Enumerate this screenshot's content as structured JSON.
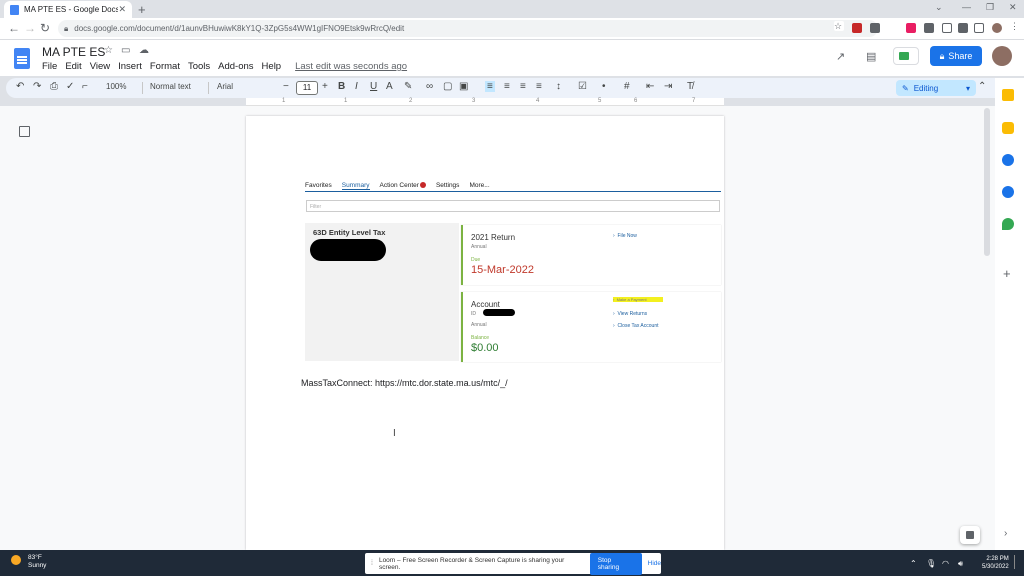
{
  "browser": {
    "tab_title": "MA PTE ES - Google Docs",
    "url": "docs.google.com/document/d/1aunvBHuwiwK8kY1Q-3ZpG5s4WW1gIFNO9Etsk9wRrcQ/edit"
  },
  "doc": {
    "title": "MA PTE ES",
    "menu": [
      "File",
      "Edit",
      "View",
      "Insert",
      "Format",
      "Tools",
      "Add-ons",
      "Help"
    ],
    "last_edit": "Last edit was seconds ago",
    "share_label": "Share",
    "editing_label": "Editing"
  },
  "format_toolbar": {
    "zoom": "100%",
    "style": "Normal text",
    "font": "Arial",
    "font_size": "11"
  },
  "ruler": {
    "marks": [
      "1",
      "1",
      "2",
      "3",
      "4",
      "5",
      "6",
      "7"
    ]
  },
  "embedded": {
    "tabs": [
      "Favorites",
      "Summary",
      "Action Center",
      "Settings",
      "More..."
    ],
    "filter_placeholder": "Filter",
    "entity_title": "63D Entity Level Tax",
    "return_card": {
      "title": "2021 Return",
      "subtitle": "Annual",
      "due_label": "Due",
      "due_date": "15-Mar-2022",
      "link": "File Now"
    },
    "account_card": {
      "title": "Account",
      "id_prefix": "ID",
      "subtitle": "Annual",
      "balance_label": "Balance",
      "balance": "$0.00",
      "links": [
        "Make a Payment",
        "View Returns",
        "Close Tax Account"
      ]
    }
  },
  "body_text": "MassTaxConnect: https://mtc.dor.state.ma.us/mtc/_/",
  "taskbar": {
    "temp": "83°F",
    "weather": "Sunny",
    "loom_text": "Loom – Free Screen Recorder & Screen Capture is sharing your screen.",
    "stop_sharing": "Stop sharing",
    "hide": "Hide",
    "time": "2:28 PM",
    "date": "5/30/2022"
  }
}
